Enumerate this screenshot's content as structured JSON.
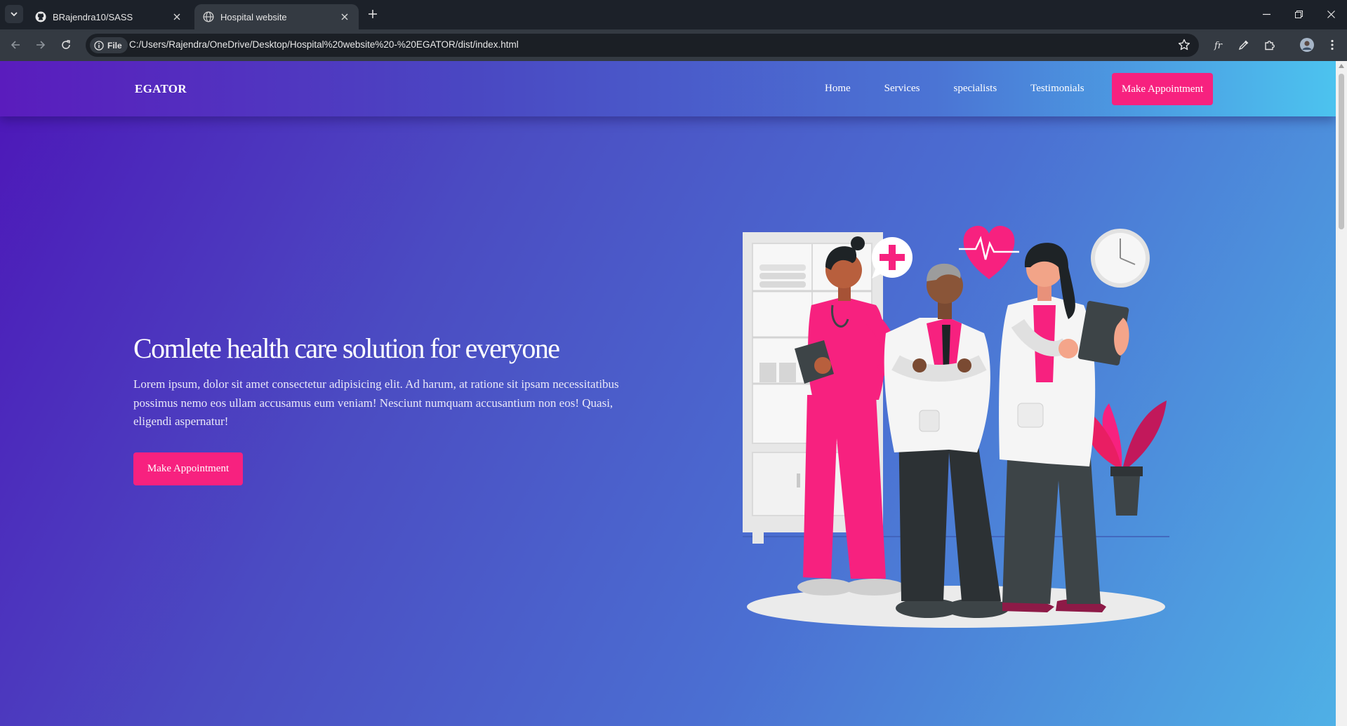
{
  "browser": {
    "tabs": [
      {
        "title": "BRajendra10/SASS",
        "active": false
      },
      {
        "title": "Hospital website",
        "active": true
      }
    ],
    "address": {
      "scheme_label": "File",
      "url": "C:/Users/Rajendra/OneDrive/Desktop/Hospital%20website%20-%20EGATOR/dist/index.html"
    }
  },
  "page": {
    "logo": "EGATOR",
    "nav": {
      "items": [
        "Home",
        "Services",
        "specialists",
        "Testimonials"
      ],
      "cta": "Make Appointment"
    },
    "hero": {
      "title": "Comlete health care solution for everyone",
      "text": "Lorem ipsum, dolor sit amet consectetur adipisicing elit. Ad harum, at ratione sit ipsam necessitatibus possimus nemo eos ullam accusamus eum veniam! Nesciunt numquam accusantium non eos! Quasi, eligendi aspernatur!",
      "cta": "Make Appointment"
    }
  },
  "colors": {
    "accent": "#f7217f",
    "gradient_start": "#4d16b8",
    "gradient_end": "#4fb1e6"
  }
}
